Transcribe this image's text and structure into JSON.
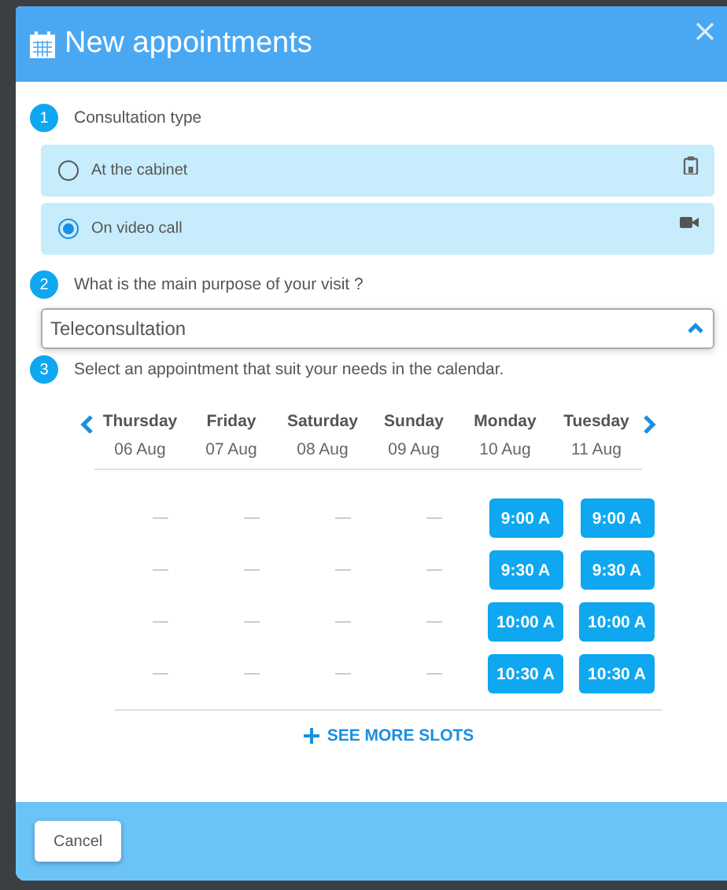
{
  "window": {
    "title": "New appointments"
  },
  "steps": [
    {
      "number": "1",
      "label": "Consultation type"
    },
    {
      "number": "2",
      "label": "What is the main purpose of your visit ?"
    },
    {
      "number": "3",
      "label": "Select an appointment that suit your needs in the calendar."
    }
  ],
  "consultation_options": [
    {
      "label": "At the cabinet",
      "selected": false,
      "kind": "cabinet"
    },
    {
      "label": "On video call",
      "selected": true,
      "kind": "video"
    }
  ],
  "purpose_select": {
    "value": "Teleconsultation",
    "expanded": true
  },
  "calendar": {
    "days": [
      {
        "name": "Thursday",
        "date": "06 Aug",
        "slots": [
          {
            "kind": "empty"
          },
          {
            "kind": "empty"
          },
          {
            "kind": "empty"
          },
          {
            "kind": "empty"
          }
        ]
      },
      {
        "name": "Friday",
        "date": "07 Aug",
        "slots": [
          {
            "kind": "empty"
          },
          {
            "kind": "empty"
          },
          {
            "kind": "empty"
          },
          {
            "kind": "empty"
          }
        ]
      },
      {
        "name": "Saturday",
        "date": "08 Aug",
        "slots": [
          {
            "kind": "empty"
          },
          {
            "kind": "empty"
          },
          {
            "kind": "empty"
          },
          {
            "kind": "empty"
          }
        ]
      },
      {
        "name": "Sunday",
        "date": "09 Aug",
        "slots": [
          {
            "kind": "empty"
          },
          {
            "kind": "empty"
          },
          {
            "kind": "empty"
          },
          {
            "kind": "empty"
          }
        ]
      },
      {
        "name": "Monday",
        "date": "10 Aug",
        "slots": [
          {
            "kind": "time",
            "label": "9:00 A"
          },
          {
            "kind": "time",
            "label": "9:30 A"
          },
          {
            "kind": "time",
            "label": "10:00 A"
          },
          {
            "kind": "time",
            "label": "10:30 A"
          }
        ]
      },
      {
        "name": "Tuesday",
        "date": "11 Aug",
        "slots": [
          {
            "kind": "time",
            "label": "9:00 A"
          },
          {
            "kind": "time",
            "label": "9:30 A"
          },
          {
            "kind": "time",
            "label": "10:00 A"
          },
          {
            "kind": "time",
            "label": "10:30 A"
          }
        ]
      }
    ],
    "more_label": "SEE MORE SLOTS"
  },
  "buttons": [
    "Cancel"
  ]
}
